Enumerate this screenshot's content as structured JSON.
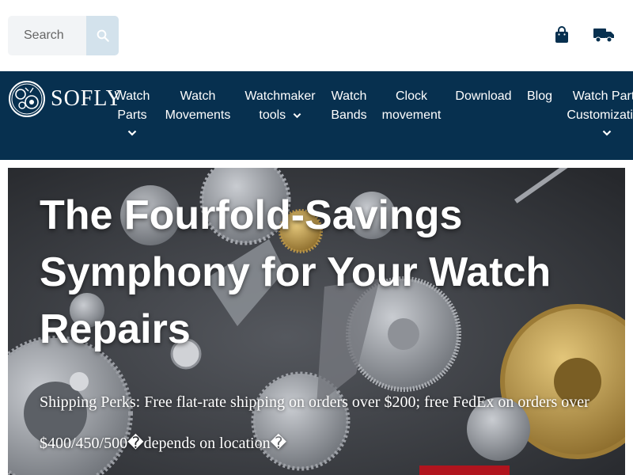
{
  "search": {
    "placeholder": "Search"
  },
  "header_icons": [
    "shopping-bag-icon",
    "delivery-truck-icon"
  ],
  "brand": {
    "name": "SOFLY"
  },
  "nav": {
    "watch_parts": [
      "Watch",
      "Parts"
    ],
    "watch_movements": [
      "Watch",
      "Movements"
    ],
    "watchmaker_tools": [
      "Watchmaker",
      "tools"
    ],
    "watch_bands": [
      "Watch",
      "Bands"
    ],
    "clock_movement": [
      "Clock",
      "movement"
    ],
    "download": "Download",
    "blog": "Blog",
    "watch_parts_customization": [
      "Watch Parts",
      "Customization"
    ]
  },
  "hero": {
    "title": "The Fourfold-Savings Symphony for Your Watch Repairs",
    "subtitle": "Shipping Perks: Free flat-rate shipping on orders over $200; free FedEx on orders over $400/450/500�depends on location�"
  },
  "colors": {
    "nav_background": "#07304f",
    "search_button": "#d3e2ec",
    "accent_button": "#b0141e",
    "icon_color": "#07304f"
  }
}
